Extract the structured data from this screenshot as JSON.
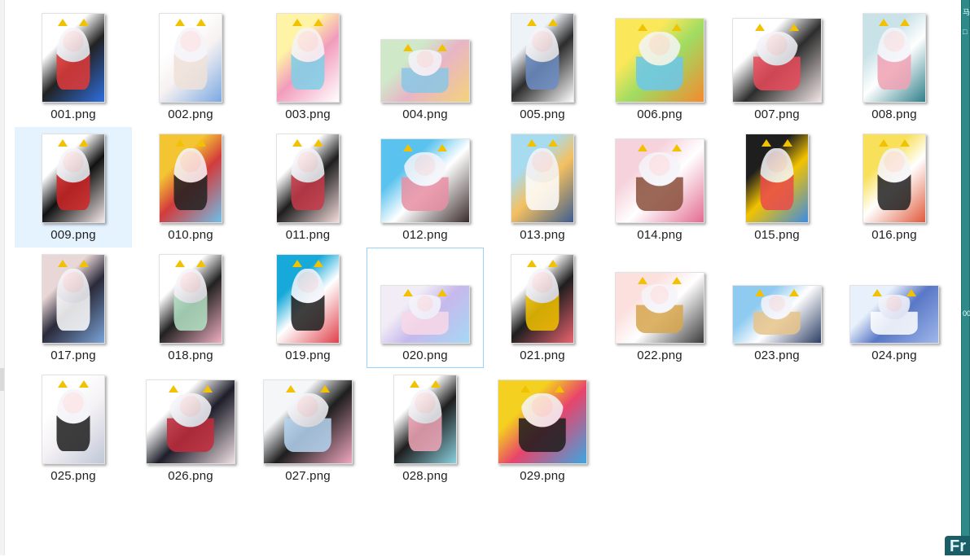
{
  "window": {
    "title": ""
  },
  "files": [
    {
      "name": "001.png",
      "shape": "portrait",
      "colors": [
        "#ffffff",
        "#222222",
        "#e23b3b",
        "#2f6fe0"
      ]
    },
    {
      "name": "002.png",
      "shape": "portrait",
      "colors": [
        "#ffffff",
        "#f7f1f1",
        "#efe2d9",
        "#7aa9e3"
      ]
    },
    {
      "name": "003.png",
      "shape": "portrait",
      "colors": [
        "#fff3a6",
        "#f29cbc",
        "#7fd0e8",
        "#ffffff"
      ]
    },
    {
      "name": "004.png",
      "shape": "wide",
      "colors": [
        "#cfe8c8",
        "#e7b5c7",
        "#8bc7e6",
        "#f4d27a"
      ]
    },
    {
      "name": "005.png",
      "shape": "portrait",
      "colors": [
        "#eef3f8",
        "#2c2c2c",
        "#6c8ec4",
        "#ffffff"
      ]
    },
    {
      "name": "006.png",
      "shape": "squareish",
      "colors": [
        "#fbe85a",
        "#9fdc62",
        "#6bc7ee",
        "#f48a2f"
      ]
    },
    {
      "name": "007.png",
      "shape": "squareish",
      "colors": [
        "#ffffff",
        "#2d2d2d",
        "#ea4b5b",
        "#f3e6e6"
      ]
    },
    {
      "name": "008.png",
      "shape": "portrait",
      "colors": [
        "#c8e2e8",
        "#ffffff",
        "#f0a2b4",
        "#2f7f8a"
      ]
    },
    {
      "name": "009.png",
      "shape": "portrait",
      "colors": [
        "#ffffff",
        "#111111",
        "#d02626",
        "#f4e9e9"
      ]
    },
    {
      "name": "010.png",
      "shape": "portrait",
      "colors": [
        "#f4c533",
        "#d33b3b",
        "#222222",
        "#6ec0e8"
      ]
    },
    {
      "name": "011.png",
      "shape": "portrait",
      "colors": [
        "#ffffff",
        "#1e1e1e",
        "#c83a4a",
        "#f5dcdc"
      ]
    },
    {
      "name": "012.png",
      "shape": "squareish",
      "colors": [
        "#59c2ee",
        "#ffffff",
        "#e88fa3",
        "#3a2b2b"
      ]
    },
    {
      "name": "013.png",
      "shape": "portrait",
      "colors": [
        "#a7dbf0",
        "#f5c060",
        "#ffffff",
        "#3d5d8f"
      ]
    },
    {
      "name": "014.png",
      "shape": "squareish",
      "colors": [
        "#f6d2dc",
        "#ffffff",
        "#8a4f3b",
        "#e36c92"
      ]
    },
    {
      "name": "015.png",
      "shape": "portrait",
      "colors": [
        "#1e1e1e",
        "#f2c200",
        "#ea4b4b",
        "#3c8ce6"
      ]
    },
    {
      "name": "016.png",
      "shape": "portrait",
      "colors": [
        "#f8e05a",
        "#ffffff",
        "#222222",
        "#e05a3b"
      ]
    },
    {
      "name": "017.png",
      "shape": "portrait",
      "colors": [
        "#e9d7d7",
        "#2a2a3a",
        "#ffffff",
        "#7aa4d8"
      ]
    },
    {
      "name": "018.png",
      "shape": "portrait",
      "colors": [
        "#ffffff",
        "#222222",
        "#b4e3c6",
        "#f0b0c2"
      ]
    },
    {
      "name": "019.png",
      "shape": "portrait",
      "colors": [
        "#17a9d9",
        "#ffffff",
        "#1e1e1e",
        "#e0414a"
      ]
    },
    {
      "name": "020.png",
      "shape": "landscape-s",
      "colors": [
        "#f1ecf6",
        "#c7b8ec",
        "#f9d9e8",
        "#a6d8f4"
      ]
    },
    {
      "name": "021.png",
      "shape": "portrait",
      "colors": [
        "#ffffff",
        "#1e1e1e",
        "#f2c200",
        "#ea6470"
      ]
    },
    {
      "name": "022.png",
      "shape": "landscape-m",
      "colors": [
        "#fbe0de",
        "#ffffff",
        "#d7a64d",
        "#3a3a3a"
      ]
    },
    {
      "name": "023.png",
      "shape": "landscape-s",
      "colors": [
        "#8fcaf0",
        "#ffffff",
        "#e8c48a",
        "#2d3f66"
      ]
    },
    {
      "name": "024.png",
      "shape": "landscape-s",
      "colors": [
        "#e7f0fb",
        "#5977c6",
        "#ffffff",
        "#9fb7ea"
      ]
    },
    {
      "name": "025.png",
      "shape": "portrait",
      "colors": [
        "#ffffff",
        "#f4f1f4",
        "#1e1e1e",
        "#c0c7d8"
      ]
    },
    {
      "name": "026.png",
      "shape": "squareish",
      "colors": [
        "#ffffff",
        "#1e1e2a",
        "#c32c3d",
        "#f0e0e3"
      ]
    },
    {
      "name": "027.png",
      "shape": "squareish",
      "colors": [
        "#f4f6f8",
        "#1e1e1e",
        "#b6d6f2",
        "#f0a7c0"
      ]
    },
    {
      "name": "028.png",
      "shape": "portrait",
      "colors": [
        "#ffffff",
        "#1e1e1e",
        "#f1a6b8",
        "#8ad0de"
      ]
    },
    {
      "name": "029.png",
      "shape": "squareish",
      "colors": [
        "#f4d020",
        "#e9446b",
        "#1e1e1e",
        "#3ba7e3"
      ]
    }
  ],
  "selection": {
    "selected": "009.png",
    "focused": "020.png"
  },
  "sidebar_right": {
    "glyph_top": "马",
    "glyph_mid": "00",
    "badge": "Fr"
  }
}
